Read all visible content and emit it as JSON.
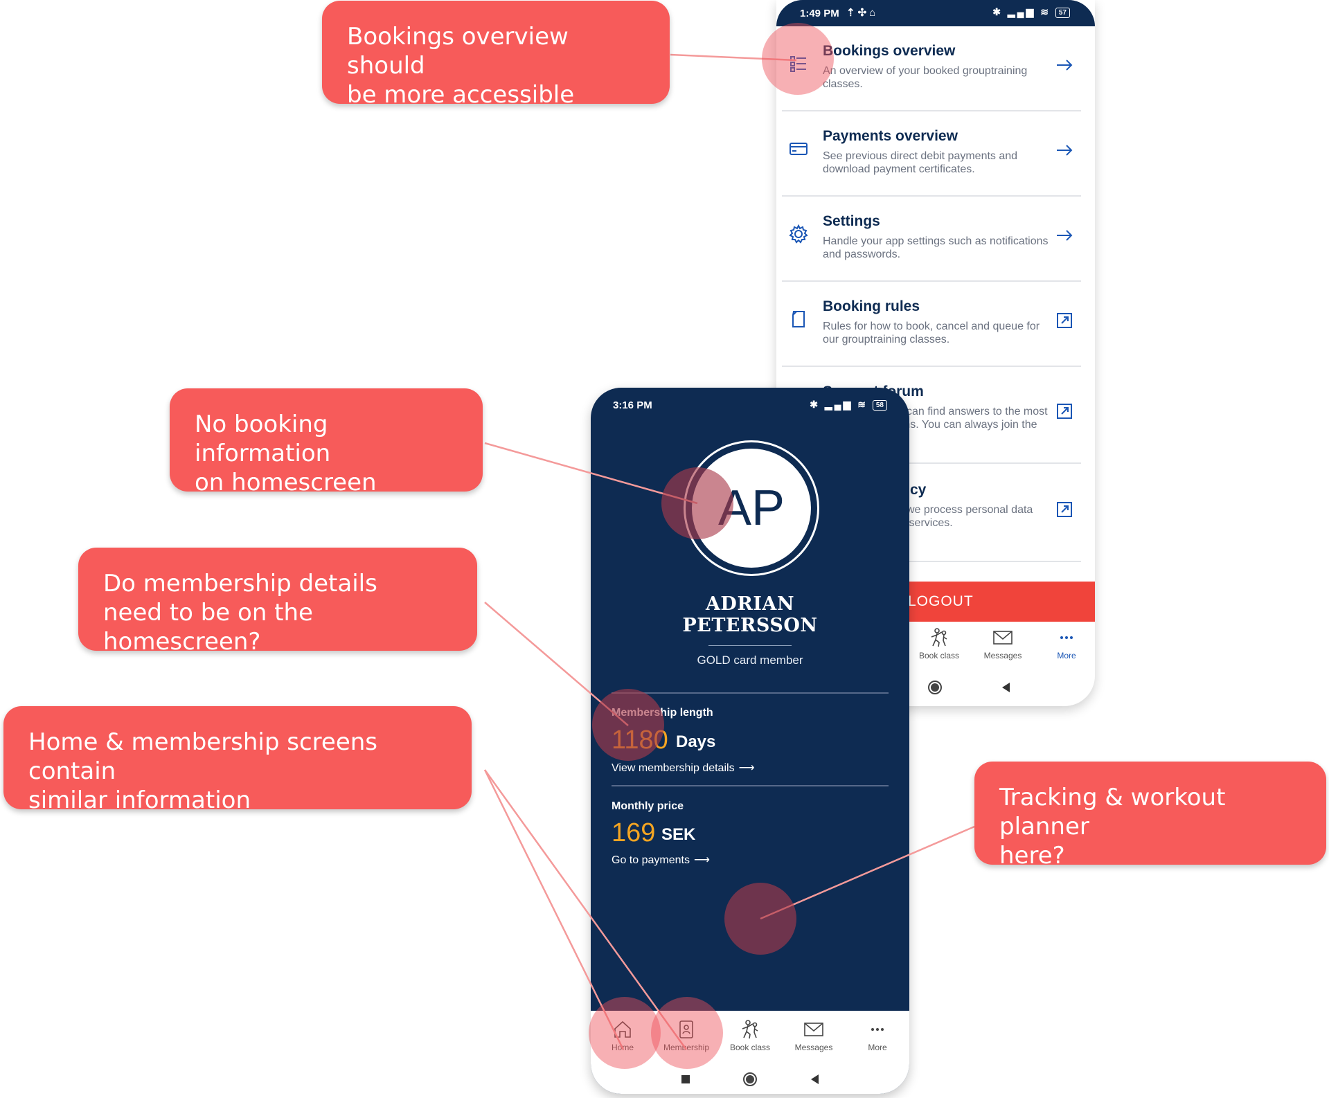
{
  "back_phone": {
    "status_time": "1:49 PM",
    "battery": "57",
    "menu": [
      {
        "icon": "list-icon",
        "title": "Bookings overview",
        "desc": "An overview of your booked grouptraining classes.",
        "action": "arrow-right-icon"
      },
      {
        "icon": "credit-card-icon",
        "title": "Payments overview",
        "desc": "See previous direct debit payments and download payment certificates.",
        "action": "arrow-right-icon"
      },
      {
        "icon": "gear-icon",
        "title": "Settings",
        "desc": "Handle your app settings such as notifications and passwords.",
        "action": "arrow-right-icon"
      },
      {
        "icon": "document-icon",
        "title": "Booking rules",
        "desc": "Rules for how to book, cancel and queue for our grouptraining classes.",
        "action": "external-link-icon"
      },
      {
        "icon": "chat-icon",
        "title": "Support forum",
        "desc": "In our forum you can find answers to the most common questions. You can always join the discussion.",
        "action": "external-link-icon"
      },
      {
        "icon": "shield-icon",
        "title": "Integrity policy",
        "desc": "Read about how we process personal data and usage of our services.",
        "action": "external-link-icon"
      }
    ],
    "logout_label": "LOGOUT",
    "nav": [
      {
        "label": "Book class",
        "icon": "workout-icon"
      },
      {
        "label": "Messages",
        "icon": "mail-icon"
      },
      {
        "label": "More",
        "icon": "more-dots-icon",
        "active": true
      }
    ]
  },
  "front_phone": {
    "status_time": "3:16 PM",
    "battery": "58",
    "initials": "AP",
    "name_line1": "ADRIAN",
    "name_line2": "PETERSSON",
    "tier": "GOLD card member",
    "membership_length_label": "Membership length",
    "membership_length_value": "1180",
    "membership_length_unit": "Days",
    "membership_link": "View membership details",
    "price_label": "Monthly price",
    "price_value": "169",
    "price_unit": "SEK",
    "price_link": "Go to payments",
    "nav": [
      {
        "label": "Home",
        "icon": "home-icon"
      },
      {
        "label": "Membership",
        "icon": "membership-card-icon"
      },
      {
        "label": "Book class",
        "icon": "workout-icon"
      },
      {
        "label": "Messages",
        "icon": "mail-icon"
      },
      {
        "label": "More",
        "icon": "more-dots-icon"
      }
    ]
  },
  "callouts": {
    "bookings": "Bookings overview should\nbe more accessible",
    "no_booking": "No booking information\non homescreen",
    "membership": "Do membership details\nneed to be on the homescreen?",
    "similar": "Home & membership screens contain\nsimilar information",
    "tracking": "Tracking & workout planner\nhere?"
  },
  "colors": {
    "navy": "#0e2b52",
    "accent_orange": "#f4a522",
    "callout_red": "#f75b5a",
    "logout_red": "#f0443b",
    "active_blue": "#1a56b5"
  }
}
